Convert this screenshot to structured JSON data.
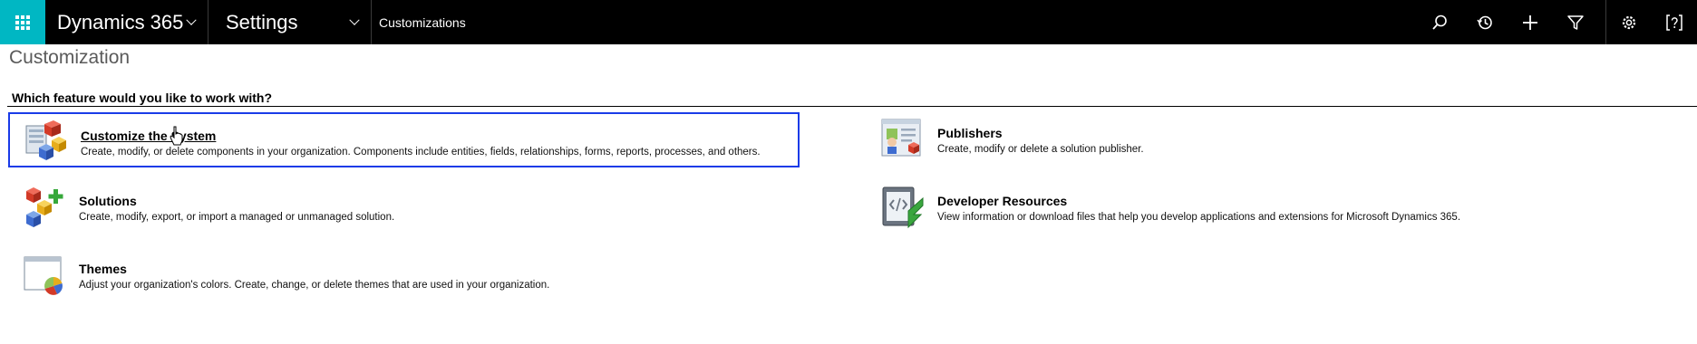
{
  "topbar": {
    "brand": "Dynamics 365",
    "area": "Settings",
    "breadcrumb": "Customizations",
    "icons": [
      "search-icon",
      "recent-icon",
      "add-icon",
      "filter-icon",
      "gear-icon",
      "help-icon"
    ],
    "accent_color": "#00b7c3"
  },
  "page": {
    "title": "Customization",
    "question": "Which feature would you like to work with?"
  },
  "features": {
    "customize": {
      "title": "Customize the System",
      "description": "Create, modify, or delete components in your organization. Components include entities, fields, relationships, forms, reports, processes, and others."
    },
    "publishers": {
      "title": "Publishers",
      "description": "Create, modify or delete a solution publisher."
    },
    "solutions": {
      "title": "Solutions",
      "description": "Create, modify, export, or import a managed or unmanaged solution."
    },
    "developer": {
      "title": "Developer Resources",
      "description": "View information or download files that help you develop applications and extensions for Microsoft Dynamics 365."
    },
    "themes": {
      "title": "Themes",
      "description": "Adjust your organization's colors. Create, change, or delete themes that are used in your organization."
    }
  },
  "selection_color": "#1a3be8"
}
